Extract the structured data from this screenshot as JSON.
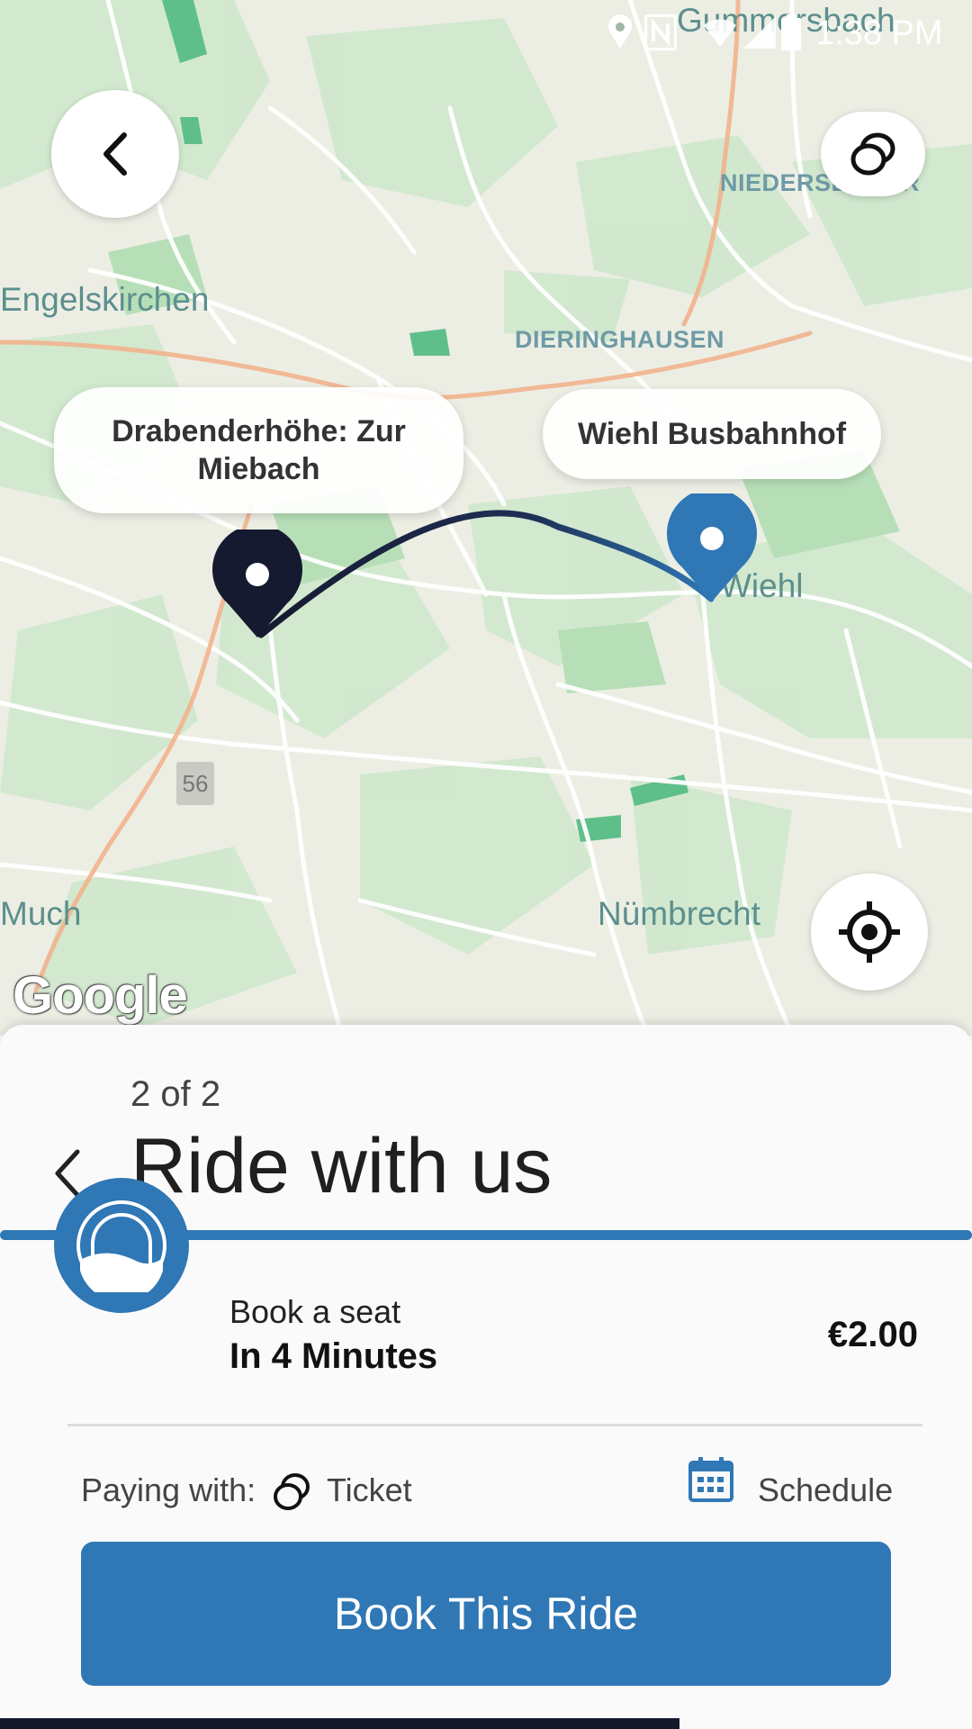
{
  "status_bar": {
    "time": "1:38 PM"
  },
  "map": {
    "towns": {
      "engelskirchen": "Engelskirchen",
      "wiehl": "Wiehl",
      "much": "Much",
      "nuembrecht": "Nümbrecht",
      "gummersbach": "Gummersbach"
    },
    "districts": {
      "dieringhausen": "DIERINGHAUSEN",
      "niederseßmar": "NIEDERSEßMAR"
    },
    "road_shield": "56",
    "origin_label": "Drabenderhöhe: Zur Miebach",
    "destination_label": "Wiehl Busbahnhof",
    "attribution": "Google",
    "colors": {
      "origin_pin": "#161a30",
      "destination_pin": "#2f77b5",
      "route_start": "#161a30",
      "route_end": "#2f77b5"
    }
  },
  "sheet": {
    "step": "2 of 2",
    "title": "Ride with us",
    "ride_option": {
      "kicker": "Book a seat",
      "eta": "In 4 Minutes",
      "price": "€2.00",
      "icon": "tunnel-icon"
    },
    "paying_with_label": "Paying with:",
    "payment_method": "Ticket",
    "schedule_label": "Schedule",
    "book_button": "Book This Ride",
    "accent_color": "#2f77b5"
  }
}
